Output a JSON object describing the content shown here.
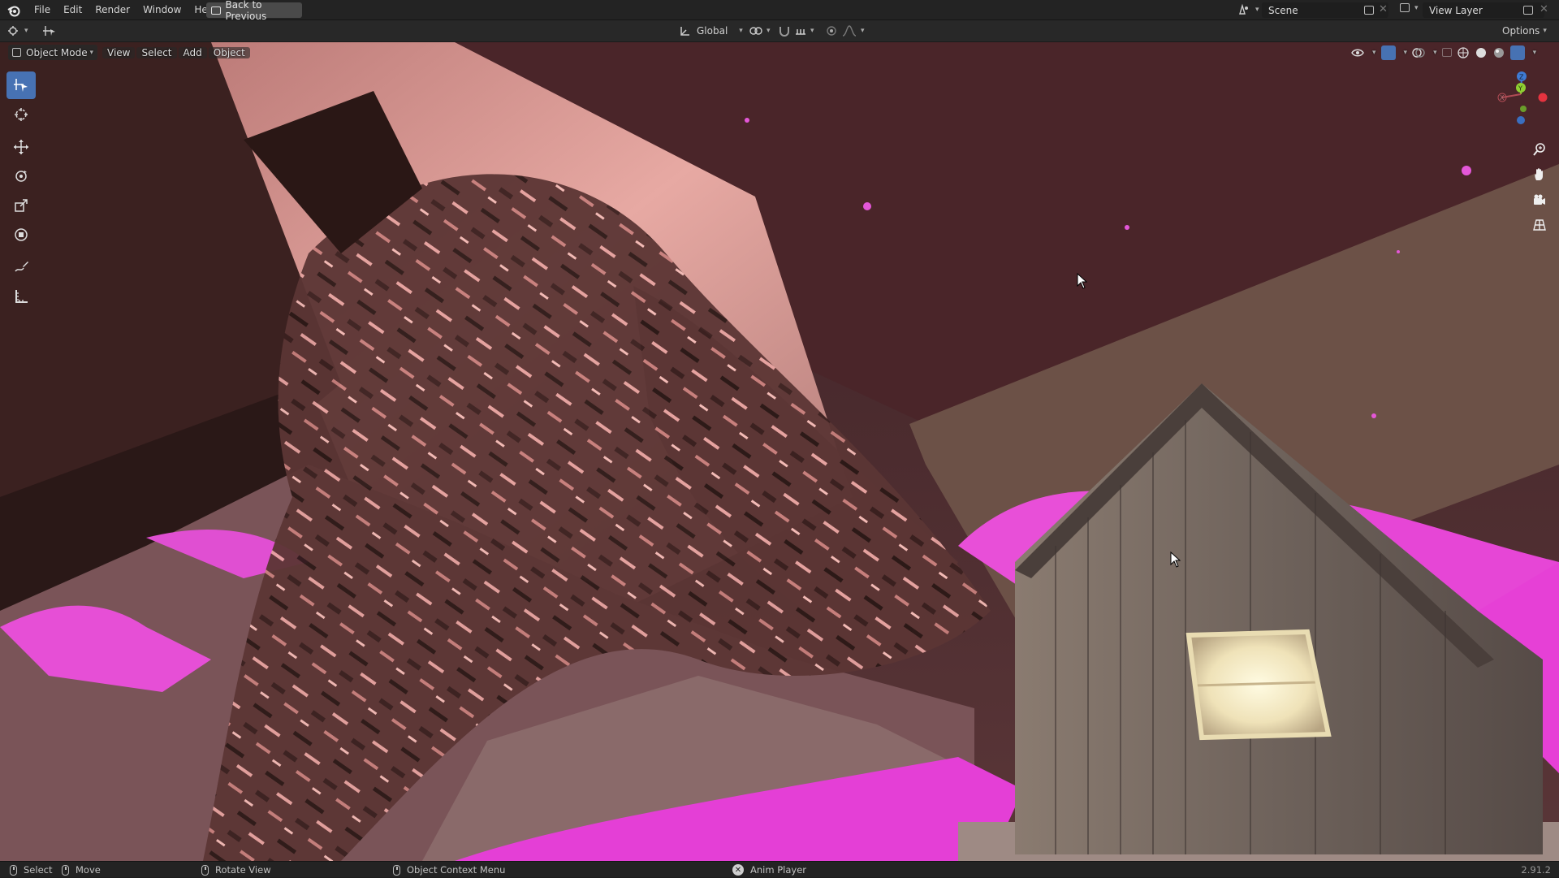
{
  "topbar": {
    "menus": [
      "File",
      "Edit",
      "Render",
      "Window",
      "Help"
    ],
    "back_button": "Back to Previous",
    "scene_name": "Scene",
    "view_layer": "View Layer"
  },
  "header": {
    "transform_orientation": "Global",
    "options_label": "Options"
  },
  "viewport": {
    "mode": "Object Mode",
    "menus": [
      "View",
      "Select",
      "Add",
      "Object"
    ],
    "gizmo_axes": [
      "X",
      "Y",
      "Z"
    ]
  },
  "statusbar": {
    "select": "Select",
    "move": "Move",
    "rotate": "Rotate View",
    "context_menu": "Object Context Menu",
    "anim_player": "Anim Player",
    "version": "2.91.2"
  },
  "colors": {
    "accent": "#4772b3",
    "magenta": "#e83fd9",
    "sky": "#4a2a2d"
  }
}
